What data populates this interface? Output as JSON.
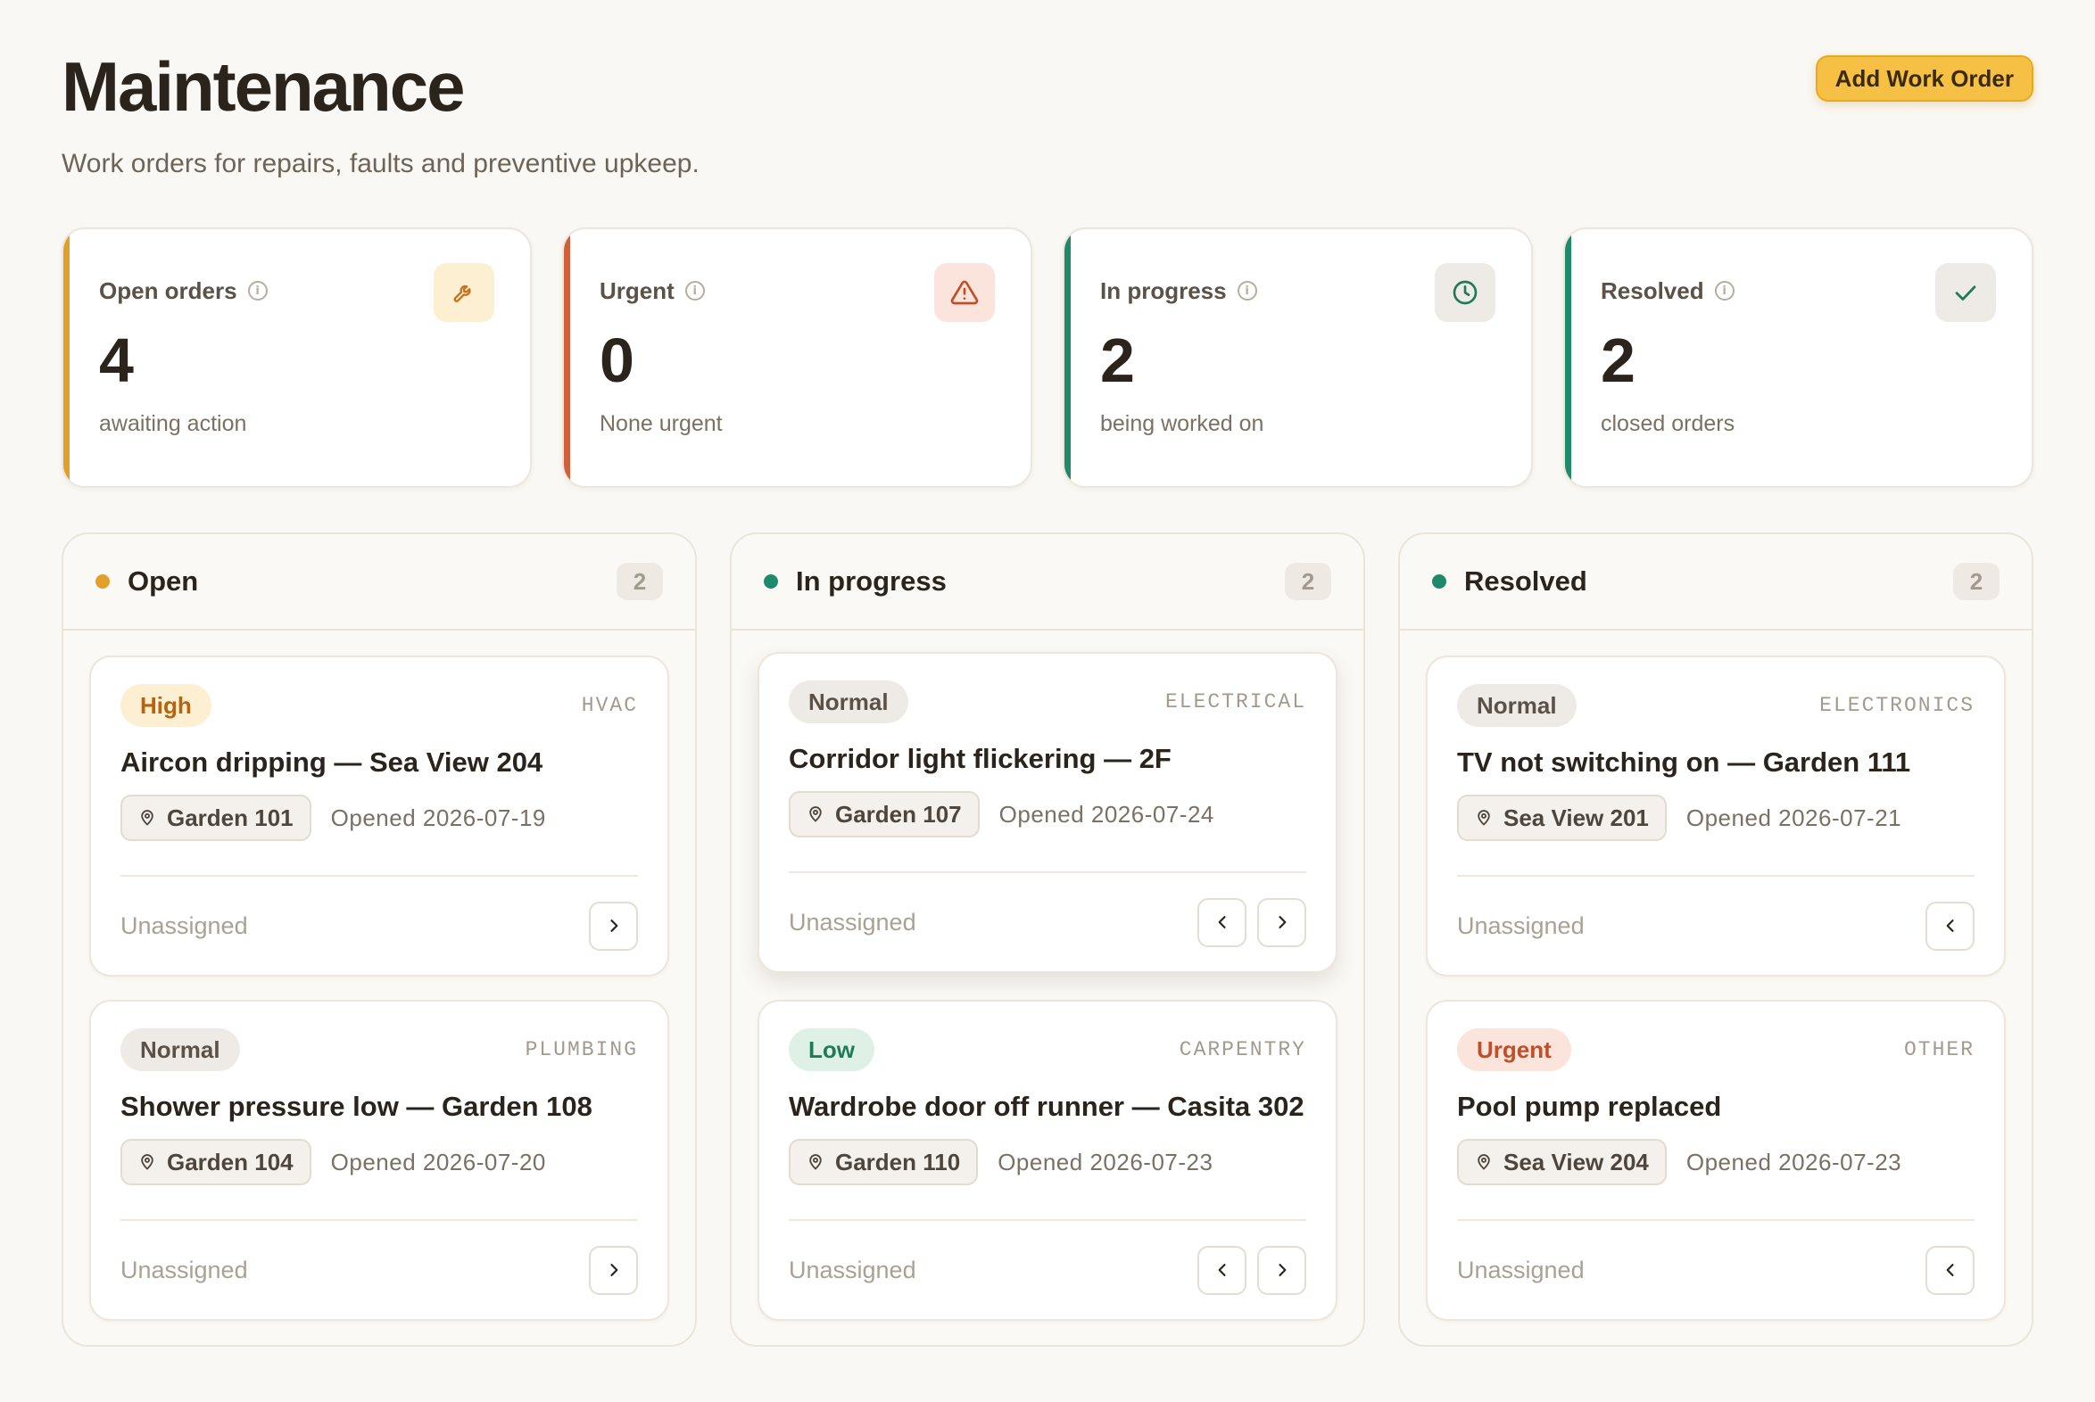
{
  "header": {
    "title": "Maintenance",
    "subtitle": "Work orders for repairs, faults and preventive upkeep.",
    "add_button": "Add Work Order"
  },
  "stats": [
    {
      "label": "Open orders",
      "value": "4",
      "caption": "awaiting action",
      "icon": "wrench-icon",
      "accent": "#e0a02b"
    },
    {
      "label": "Urgent",
      "value": "0",
      "caption": "None urgent",
      "icon": "warning-icon",
      "accent": "#d0603a"
    },
    {
      "label": "In progress",
      "value": "2",
      "caption": "being worked on",
      "icon": "clock-icon",
      "accent": "#1f8a6a"
    },
    {
      "label": "Resolved",
      "value": "2",
      "caption": "closed orders",
      "icon": "check-icon",
      "accent": "#1f8a6a"
    }
  ],
  "columns": [
    {
      "title": "Open",
      "count": "2",
      "dot_color": "#e0a02b",
      "cards": [
        {
          "priority": "High",
          "category": "HVAC",
          "title": "Aircon dripping — Sea View 204",
          "location": "Garden 101",
          "opened": "Opened 2026-07-19",
          "assignee": "Unassigned"
        },
        {
          "priority": "Normal",
          "category": "PLUMBING",
          "title": "Shower pressure low — Garden 108",
          "location": "Garden 104",
          "opened": "Opened 2026-07-20",
          "assignee": "Unassigned"
        }
      ]
    },
    {
      "title": "In progress",
      "count": "2",
      "dot_color": "#1f8a6a",
      "cards": [
        {
          "priority": "Normal",
          "category": "ELECTRICAL",
          "title": "Corridor light flickering — 2F",
          "location": "Garden 107",
          "opened": "Opened 2026-07-24",
          "assignee": "Unassigned"
        },
        {
          "priority": "Low",
          "category": "CARPENTRY",
          "title": "Wardrobe door off runner — Casita 302",
          "location": "Garden 110",
          "opened": "Opened 2026-07-23",
          "assignee": "Unassigned"
        }
      ]
    },
    {
      "title": "Resolved",
      "count": "2",
      "dot_color": "#1f8a6a",
      "cards": [
        {
          "priority": "Normal",
          "category": "ELECTRONICS",
          "title": "TV not switching on — Garden 111",
          "location": "Sea View 201",
          "opened": "Opened 2026-07-21",
          "assignee": "Unassigned"
        },
        {
          "priority": "Urgent",
          "category": "OTHER",
          "title": "Pool pump replaced",
          "location": "Sea View 204",
          "opened": "Opened 2026-07-23",
          "assignee": "Unassigned"
        }
      ]
    }
  ],
  "priority_colors": {
    "High": {
      "bg": "#fcefd2",
      "fg": "#b6620f"
    },
    "Normal": {
      "bg": "#eeebe6",
      "fg": "#5b5147"
    },
    "Low": {
      "bg": "#dff0e7",
      "fg": "#1f7a58"
    },
    "Urgent": {
      "bg": "#fbe4dc",
      "fg": "#c24e28"
    }
  },
  "icons": {
    "info": "info-icon",
    "location": "map-pin-icon",
    "next": "chevron-right-icon",
    "prev": "chevron-left-icon"
  }
}
